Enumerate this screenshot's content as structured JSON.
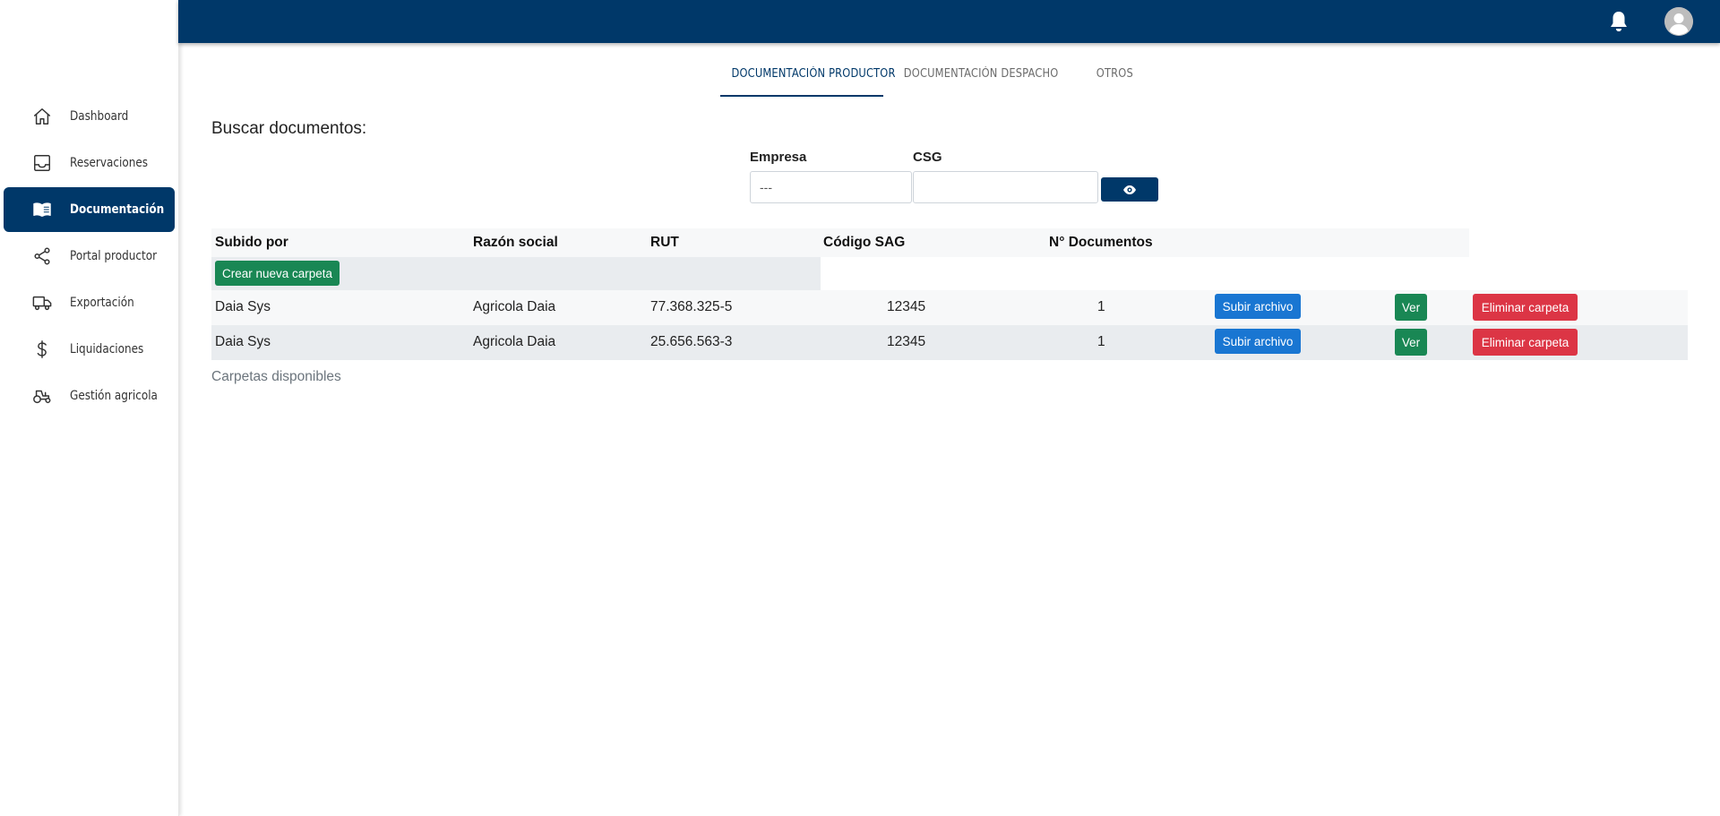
{
  "sidebar": {
    "items": [
      {
        "label": "Dashboard",
        "icon": "home-icon",
        "active": false
      },
      {
        "label": "Reservaciones",
        "icon": "inbox-icon",
        "active": false
      },
      {
        "label": "Documentación",
        "icon": "book-icon",
        "active": true
      },
      {
        "label": "Portal productor",
        "icon": "share-icon",
        "active": false
      },
      {
        "label": "Exportación",
        "icon": "truck-icon",
        "active": false
      },
      {
        "label": "Liquidaciones",
        "icon": "dollar-icon",
        "active": false
      },
      {
        "label": "Gestión agricola",
        "icon": "tractor-icon",
        "active": false
      }
    ]
  },
  "topbar": {
    "notification_icon": "bell-icon",
    "avatar_icon": "user-avatar-icon"
  },
  "tabs": [
    {
      "label": "DOCUMENTACIÓN PRODUCTOR",
      "active": true
    },
    {
      "label": "DOCUMENTACIÓN DESPACHO",
      "active": false
    },
    {
      "label": "OTROS",
      "active": false
    }
  ],
  "search": {
    "title": "Buscar documentos:",
    "empresa_label": "Empresa",
    "empresa_value": "---",
    "csg_label": "CSG",
    "csg_value": "",
    "view_button_icon": "eye-icon"
  },
  "table": {
    "headers": [
      "Subido por",
      "Razón social",
      "RUT",
      "Código SAG",
      "N° Documentos"
    ],
    "create_button": "Crear nueva carpeta",
    "rows": [
      {
        "subido_por": "Daia Sys",
        "razon_social": "Agricola Daia",
        "rut": "77.368.325-5",
        "codigo_sag": "12345",
        "n_documentos": "1"
      },
      {
        "subido_por": "Daia Sys",
        "razon_social": "Agricola Daia",
        "rut": "25.656.563-3",
        "codigo_sag": "12345",
        "n_documentos": "1"
      }
    ],
    "actions": {
      "upload": "Subir archivo",
      "view": "Ver",
      "delete": "Eliminar carpeta"
    },
    "caption": "Carpetas disponibles"
  },
  "colors": {
    "primary": "#003869",
    "success": "#198754",
    "info": "#1976d2",
    "danger": "#dc3545"
  }
}
